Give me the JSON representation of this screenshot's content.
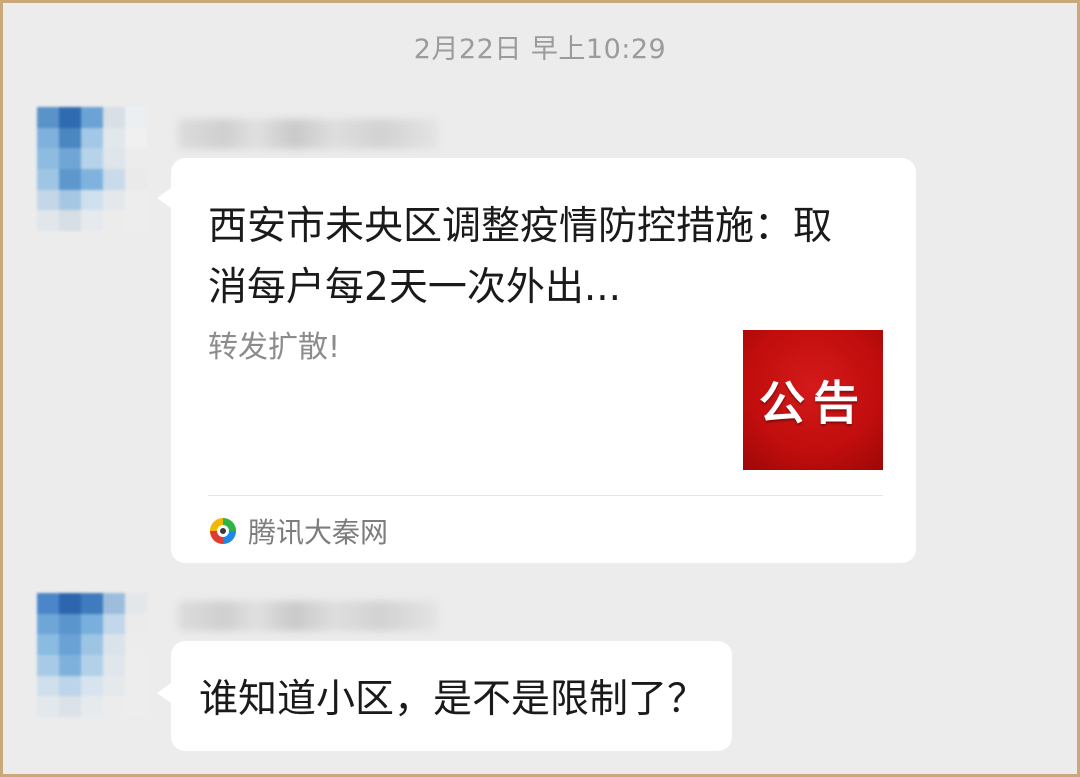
{
  "timestamp": "2月22日 早上10:29",
  "messages": [
    {
      "type": "link-card",
      "avatar_colors": [
        "#5a93c9",
        "#2f6bb0",
        "#6aa3d4",
        "#d8dfe6",
        "#eceff2",
        "#7fb1dc",
        "#4a86c0",
        "#a3c7e6",
        "#e2e7ec",
        "#f0f0f0",
        "#8dbce0",
        "#6fa6d6",
        "#b7d3ea",
        "#dfe5ea",
        "#ececec",
        "#9fc5e4",
        "#5d98cd",
        "#7fb3de",
        "#c9dbea",
        "#eaeaea",
        "#c3d7e8",
        "#a6c7e4",
        "#cfe0ee",
        "#e4e8ec",
        "#ededed",
        "#e1e6eb",
        "#d6dee6",
        "#e6eaee",
        "#ececec",
        "#ededed"
      ],
      "title": "西安市未央区调整疫情防控措施：取消每户每2天一次外出...",
      "summary": "转发扩散!",
      "thumbnail_text": "公告",
      "thumbnail_color": "#c10d0d",
      "source_icon": "tencent-news-icon",
      "source": "腾讯大秦网"
    },
    {
      "type": "text",
      "avatar_colors": [
        "#4a86c8",
        "#2e66ad",
        "#3f7bbd",
        "#9cbedc",
        "#e4e7ea",
        "#6ea6d8",
        "#5b95cd",
        "#78afdd",
        "#c2d7ea",
        "#ebebeb",
        "#8abbe1",
        "#6aa2d5",
        "#9ec4e4",
        "#dbe3ea",
        "#ececec",
        "#a9cae6",
        "#7eb2dd",
        "#b3d0e9",
        "#e0e6eb",
        "#ededed",
        "#cfdfec",
        "#bcd5ea",
        "#d7e4ef",
        "#e6e9ec",
        "#ededed",
        "#e3e8ec",
        "#dbe2e8",
        "#e7eaed",
        "#ececec",
        "#ededed"
      ],
      "text": "谁知道小区，是不是限制了？"
    }
  ]
}
